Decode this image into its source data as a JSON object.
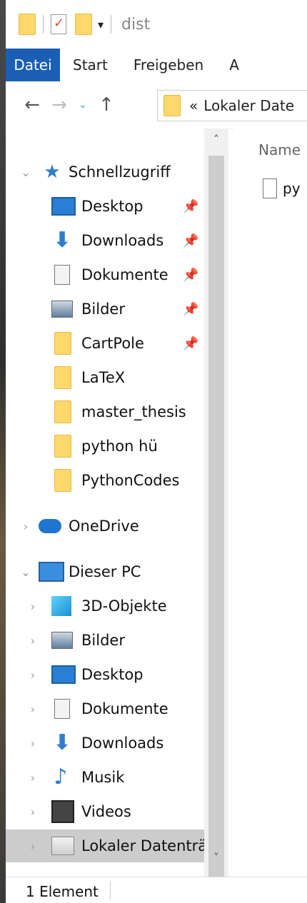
{
  "window": {
    "title": "dist"
  },
  "ribbon": {
    "tabs": [
      "Datei",
      "Start",
      "Freigeben",
      "A"
    ]
  },
  "nav": {
    "back_icon": "arrow-left-icon",
    "forward_icon": "arrow-right-icon",
    "recent_icon": "chevron-down-icon",
    "up_icon": "arrow-up-icon",
    "address_text": "Lokaler Date"
  },
  "tree": {
    "quick_access": {
      "label": "Schnellzugriff",
      "items": [
        {
          "label": "Desktop",
          "icon": "desktop-icon",
          "pinned": true
        },
        {
          "label": "Downloads",
          "icon": "downloads-icon",
          "pinned": true
        },
        {
          "label": "Dokumente",
          "icon": "documents-icon",
          "pinned": true
        },
        {
          "label": "Bilder",
          "icon": "pictures-icon",
          "pinned": true
        },
        {
          "label": "CartPole",
          "icon": "folder-icon",
          "pinned": true
        },
        {
          "label": "LaTeX",
          "icon": "folder-icon",
          "pinned": false
        },
        {
          "label": "master_thesis",
          "icon": "folder-icon",
          "pinned": false
        },
        {
          "label": "python hü",
          "icon": "folder-icon",
          "pinned": false
        },
        {
          "label": "PythonCodes",
          "icon": "folder-icon",
          "pinned": false
        }
      ]
    },
    "onedrive": {
      "label": "OneDrive"
    },
    "this_pc": {
      "label": "Dieser PC",
      "items": [
        {
          "label": "3D-Objekte",
          "icon": "3d-objects-icon"
        },
        {
          "label": "Bilder",
          "icon": "pictures-icon"
        },
        {
          "label": "Desktop",
          "icon": "desktop-icon"
        },
        {
          "label": "Dokumente",
          "icon": "documents-icon"
        },
        {
          "label": "Downloads",
          "icon": "downloads-icon"
        },
        {
          "label": "Musik",
          "icon": "music-icon"
        },
        {
          "label": "Videos",
          "icon": "videos-icon"
        },
        {
          "label": "Lokaler Datenträ",
          "icon": "local-disk-icon",
          "selected": true
        }
      ]
    }
  },
  "content": {
    "column_header": "Name",
    "files": [
      {
        "label": "py",
        "icon": "file-icon"
      }
    ]
  },
  "status": {
    "count_text": "1 Element"
  }
}
